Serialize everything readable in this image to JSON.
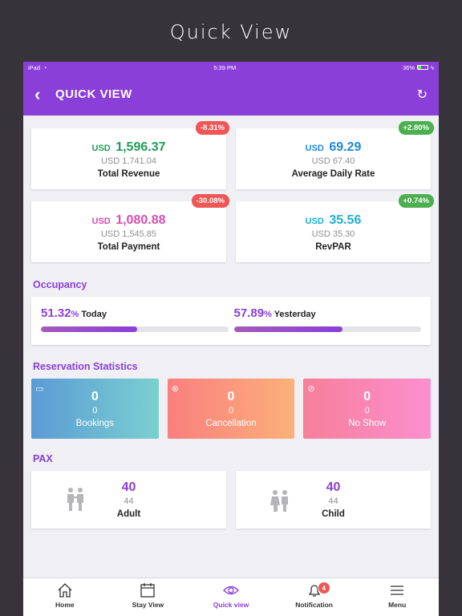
{
  "promo_title": "Quick View",
  "status_bar": {
    "device": "iPad",
    "time": "5:39 PM",
    "battery": "36%"
  },
  "header": {
    "title": "QUICK VIEW"
  },
  "summary_cards": [
    {
      "label": "Total Revenue",
      "currency": "USD",
      "value": "1,596.37",
      "previous": "USD 1,741.04",
      "change": "-8.31%",
      "color": "#1e9e56"
    },
    {
      "label": "Average Daily Rate",
      "currency": "USD",
      "value": "69.29",
      "previous": "USD 67.40",
      "change": "+2.80%",
      "color": "#1e88d8"
    },
    {
      "label": "Total Payment",
      "currency": "USD",
      "value": "1,080.88",
      "previous": "USD 1,545.85",
      "change": "-30.08%",
      "color": "#d64db3"
    },
    {
      "label": "RevPAR",
      "currency": "USD",
      "value": "35.56",
      "previous": "USD 35.30",
      "change": "+0.74%",
      "color": "#1eaecf"
    }
  ],
  "occupancy": {
    "title": "Occupancy",
    "today": {
      "value": "51.32",
      "unit": "%",
      "label": "Today",
      "fraction": 0.5132
    },
    "yesterday": {
      "value": "57.89",
      "unit": "%",
      "label": "Yesterday",
      "fraction": 0.5789
    }
  },
  "reservation": {
    "title": "Reservation Statistics",
    "items": [
      {
        "label": "Bookings",
        "value": "0",
        "sub": "0",
        "icon": "calendar-icon"
      },
      {
        "label": "Cancellation",
        "value": "0",
        "sub": "0",
        "icon": "cancel-circle-icon"
      },
      {
        "label": "No Show",
        "value": "0",
        "sub": "0",
        "icon": "eye-slash-icon"
      }
    ]
  },
  "pax": {
    "title": "PAX",
    "items": [
      {
        "label": "Adult",
        "value": "40",
        "sub": "44",
        "icon": "adults-icon"
      },
      {
        "label": "Child",
        "value": "40",
        "sub": "44",
        "icon": "child-icon"
      }
    ]
  },
  "tabs": [
    {
      "label": "Home",
      "icon": "home-icon"
    },
    {
      "label": "Stay View",
      "icon": "calendar-icon"
    },
    {
      "label": "Quick view",
      "icon": "eye-icon",
      "active": true
    },
    {
      "label": "Notification",
      "icon": "bell-icon",
      "badge": "4"
    },
    {
      "label": "Menu",
      "icon": "hamburger-icon"
    }
  ],
  "colors": {
    "accent": "#8a3fd8",
    "negative": "#ef5757",
    "positive": "#4caf50"
  }
}
